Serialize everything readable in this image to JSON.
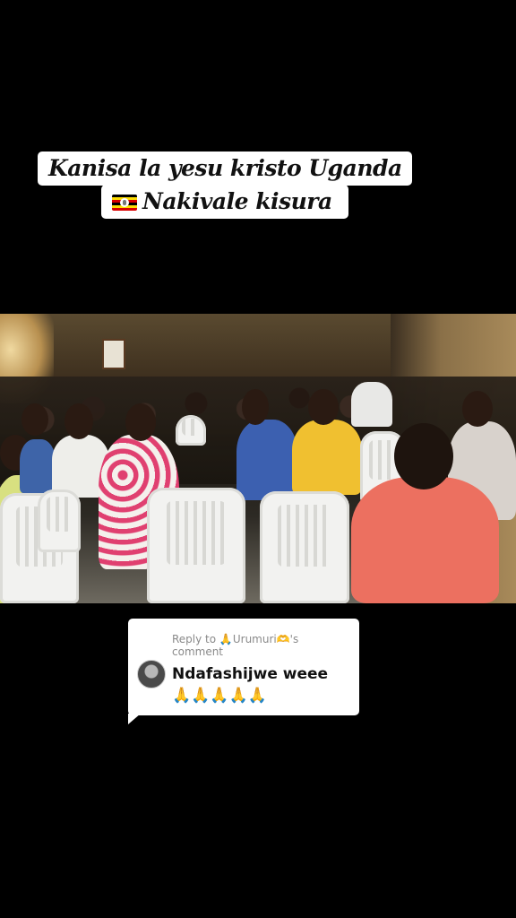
{
  "caption": {
    "line1": "Kanisa la yesu kristo Uganda",
    "line2": "Nakivale kisura",
    "flag_icon": "uganda-flag-icon",
    "flag_colors": [
      "#000000",
      "#FCDC04",
      "#D90000"
    ]
  },
  "reply": {
    "label": "Reply to 🙏Urumuri🫶's comment",
    "comment": "Ndafashijwe weee 🙏🙏🙏🙏🙏"
  }
}
